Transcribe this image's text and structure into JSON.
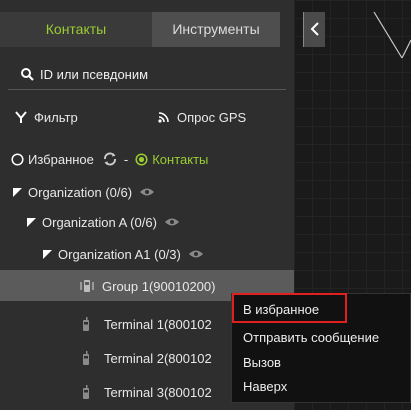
{
  "tabs": {
    "contacts": "Контакты",
    "tools": "Инструменты"
  },
  "search": {
    "placeholder": "ID или псевдоним"
  },
  "filter": {
    "filter_label": "Фильтр",
    "gps_label": "Опрос GPS"
  },
  "radio": {
    "favorites": "Избранное",
    "separator": "-",
    "contacts": "Контакты",
    "selected": "contacts"
  },
  "tree": [
    {
      "label": "Organization (0/6)"
    },
    {
      "label": "Organization A (0/6)"
    },
    {
      "label": "Organization A1 (0/3)"
    },
    {
      "label": "Group 1(90010200)"
    },
    {
      "label": "Terminal 1(800102"
    },
    {
      "label": "Terminal 2(800102"
    },
    {
      "label": "Terminal 3(800102"
    }
  ],
  "context_menu": {
    "items": [
      "В избранное",
      "Отправить сообщение",
      "Вызов",
      "Наверх"
    ]
  },
  "colors": {
    "accent": "#9acd32",
    "highlight_border": "#e02020",
    "selected_row": "#5b5b5b"
  }
}
